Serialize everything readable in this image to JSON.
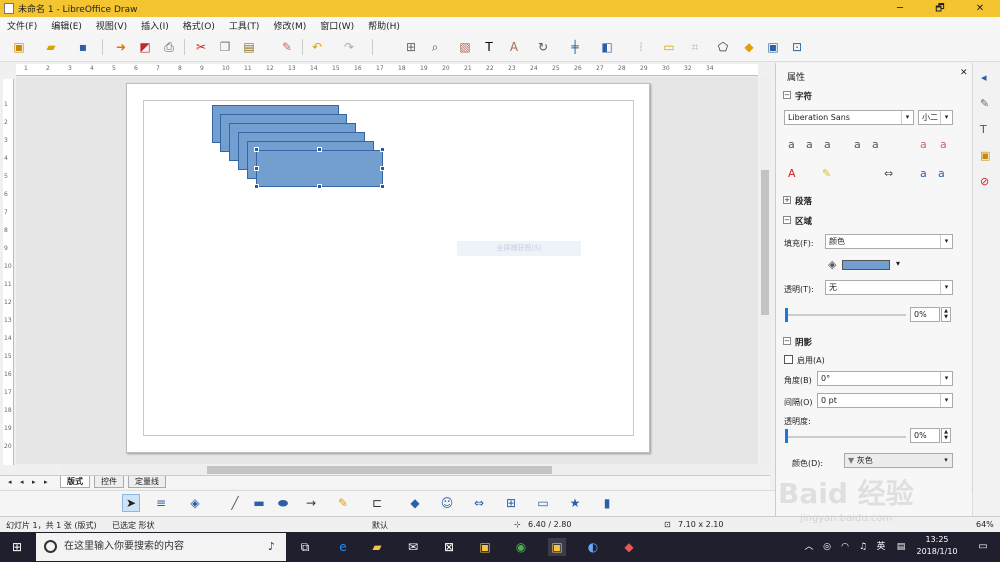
{
  "window": {
    "title": "未命名 1 - LibreOffice Draw",
    "minimize": "─",
    "maximize": "🗗",
    "close": "✕"
  },
  "menu": [
    "文件(F)",
    "编辑(E)",
    "视图(V)",
    "插入(I)",
    "格式(O)",
    "工具(T)",
    "修改(M)",
    "窗口(W)",
    "帮助(H)"
  ],
  "ruler": {
    "h_ticks": [
      "1",
      "2",
      "3",
      "4",
      "5",
      "6",
      "7",
      "8",
      "9",
      "10",
      "11",
      "12",
      "13",
      "14",
      "15",
      "16",
      "17",
      "18",
      "19",
      "20",
      "21",
      "22",
      "23",
      "24",
      "25",
      "26",
      "27",
      "28",
      "29",
      "30",
      "32",
      "34"
    ],
    "v_ticks": [
      "1",
      "2",
      "3",
      "4",
      "5",
      "6",
      "7",
      "8",
      "9",
      "10",
      "11",
      "12",
      "13",
      "14",
      "15",
      "16",
      "17",
      "18",
      "19",
      "20"
    ]
  },
  "canvas": {
    "capture_hint": "全屏捕获图(S)"
  },
  "tabs": {
    "items": [
      "版式",
      "控件",
      "定量线"
    ],
    "active": "版式",
    "nav": [
      "◂",
      "◂",
      "▸",
      "▸"
    ]
  },
  "status": {
    "slide": "幻灯片 1，共 1 张 (版式)",
    "selection": "已选定 形状",
    "master": "默认",
    "position": "6.40 / 2.80",
    "size": "7.10 x 2.10",
    "zoom": "64%"
  },
  "sidebar": {
    "title": "属性",
    "character": {
      "header": "字符",
      "font": "Liberation Sans",
      "size": "小二"
    },
    "paragraph": {
      "header": "段落"
    },
    "area": {
      "header": "区域",
      "fill_label": "填充(F):",
      "fill_value": "颜色",
      "transparency_label": "透明(T):",
      "transparency_value": "无",
      "transparency_pct": "0%",
      "fill_color": "#729fcf"
    },
    "shadow": {
      "header": "阴影",
      "enable_label": "启用(A)",
      "angle_label": "角度(B)",
      "angle_value": "0°",
      "distance_label": "间隔(O)",
      "distance_value": "0 pt",
      "transparency_label": "透明度:",
      "transparency_pct": "0%",
      "color_label": "颜色(D):",
      "color_value": "灰色"
    }
  },
  "taskbar": {
    "search_placeholder": "在这里输入你要搜索的内容",
    "ime": "英",
    "time": "13:25",
    "date": "2018/1/10"
  },
  "watermark": {
    "logo": "Baid 经验",
    "url": "jingyan.baidu.com"
  }
}
